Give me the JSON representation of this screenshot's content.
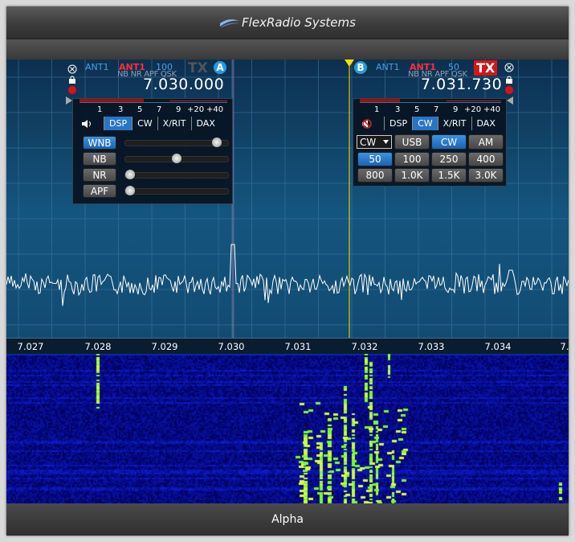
{
  "app": {
    "brand": "FlexRadio Systems",
    "status_label": "Alpha"
  },
  "axis": {
    "labels": [
      "7.027",
      "7.028",
      "7.029",
      "7.030",
      "7.031",
      "7.032",
      "7.033",
      "7.034",
      "7."
    ]
  },
  "slice_a": {
    "letter": "A",
    "rx_ant": "ANT1",
    "tx_ant": "ANT1",
    "power": "100",
    "tx": "TX",
    "nb_line": "NB NR APF QSK",
    "frequency": "7.030.000",
    "scale": [
      "1",
      "3",
      "5",
      "7",
      "9",
      "+20",
      "+40"
    ],
    "tabs": [
      "DSP",
      "CW",
      "X/RIT",
      "DAX"
    ],
    "dsp": [
      {
        "label": "WNB",
        "active": true,
        "level": 0.93
      },
      {
        "label": "NB",
        "active": false,
        "level": 0.5
      },
      {
        "label": "NR",
        "active": false,
        "level": 0.0
      },
      {
        "label": "APF",
        "active": false,
        "level": 0.0
      }
    ]
  },
  "slice_b": {
    "letter": "B",
    "rx_ant": "ANT1",
    "tx_ant": "ANT1",
    "power": "50",
    "tx": "TX",
    "nb_line": "NB NR APF QSK",
    "frequency": "7.031.730",
    "scale": [
      "1",
      "3",
      "5",
      "7",
      "9",
      "+20",
      "+40"
    ],
    "tabs": [
      "DSP",
      "CW",
      "X/RIT",
      "DAX"
    ],
    "mode_select": "CW",
    "modes": [
      "USB",
      "CW",
      "AM"
    ],
    "filters": [
      "50",
      "100",
      "250",
      "400",
      "800",
      "1.0K",
      "1.5K",
      "3.0K"
    ],
    "active_filter": "50"
  },
  "colors": {
    "accent": "#2a74c4",
    "tx_red": "#d01818",
    "marker": "#ffe000"
  }
}
